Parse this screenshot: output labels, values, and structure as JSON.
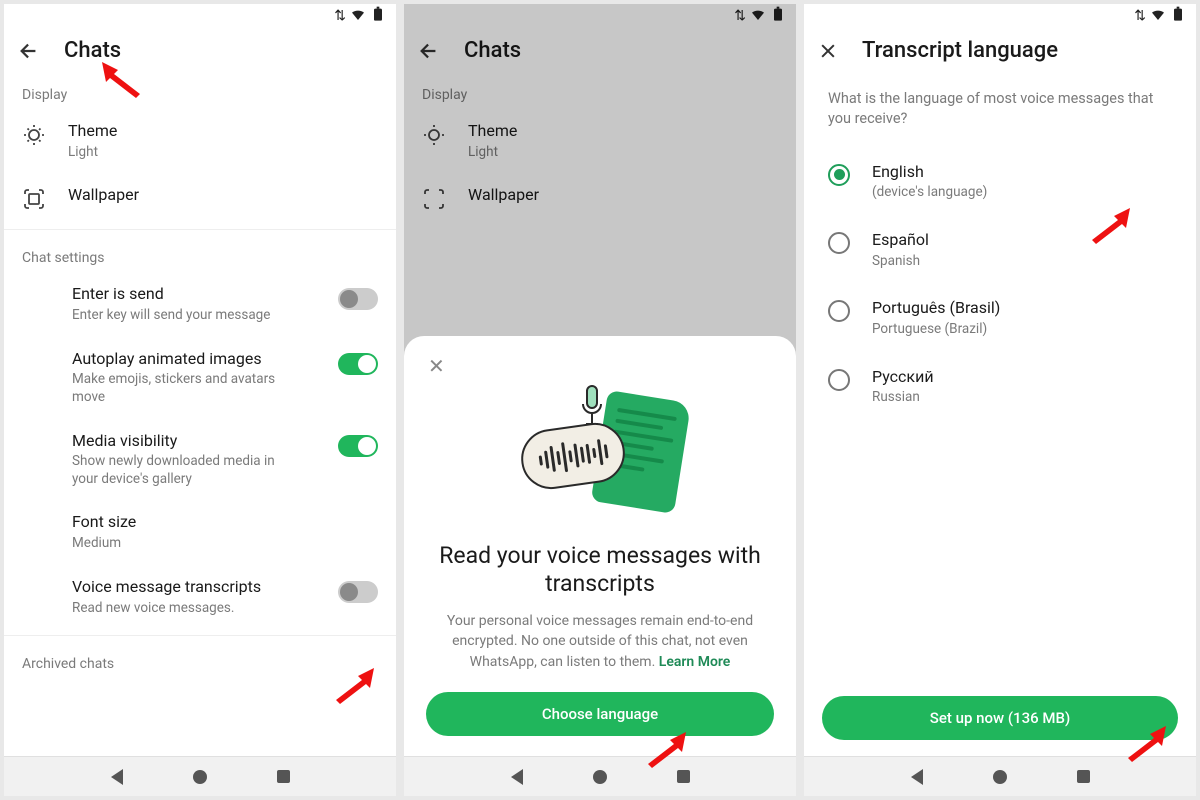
{
  "screen1": {
    "title": "Chats",
    "sections": {
      "display_label": "Display",
      "theme_title": "Theme",
      "theme_value": "Light",
      "wallpaper_title": "Wallpaper",
      "chat_settings_label": "Chat settings",
      "enter_send_title": "Enter is send",
      "enter_send_sub": "Enter key will send your message",
      "autoplay_title": "Autoplay animated images",
      "autoplay_sub": "Make emojis, stickers and avatars move",
      "media_vis_title": "Media visibility",
      "media_vis_sub": "Show newly downloaded media in your device's gallery",
      "font_size_title": "Font size",
      "font_size_value": "Medium",
      "transcripts_title": "Voice message transcripts",
      "transcripts_sub": "Read new voice messages.",
      "archived_label": "Archived chats"
    }
  },
  "screen2": {
    "title": "Chats",
    "display_label": "Display",
    "theme_title": "Theme",
    "theme_value": "Light",
    "wallpaper_title": "Wallpaper",
    "sheet": {
      "headline": "Read your voice messages with transcripts",
      "body_a": "Your personal voice messages remain end-to-end encrypted. No one outside of this chat, not even WhatsApp, can listen to them. ",
      "learn_more": "Learn More",
      "cta": "Choose language"
    }
  },
  "screen3": {
    "title": "Transcript language",
    "prompt": "What is the language of most voice messages that you receive?",
    "options": [
      {
        "label": "English",
        "sub": "(device's language)",
        "selected": true
      },
      {
        "label": "Español",
        "sub": "Spanish",
        "selected": false
      },
      {
        "label": "Português (Brasil)",
        "sub": "Portuguese (Brazil)",
        "selected": false
      },
      {
        "label": "Русский",
        "sub": "Russian",
        "selected": false
      }
    ],
    "cta": "Set up now (136 MB)"
  }
}
